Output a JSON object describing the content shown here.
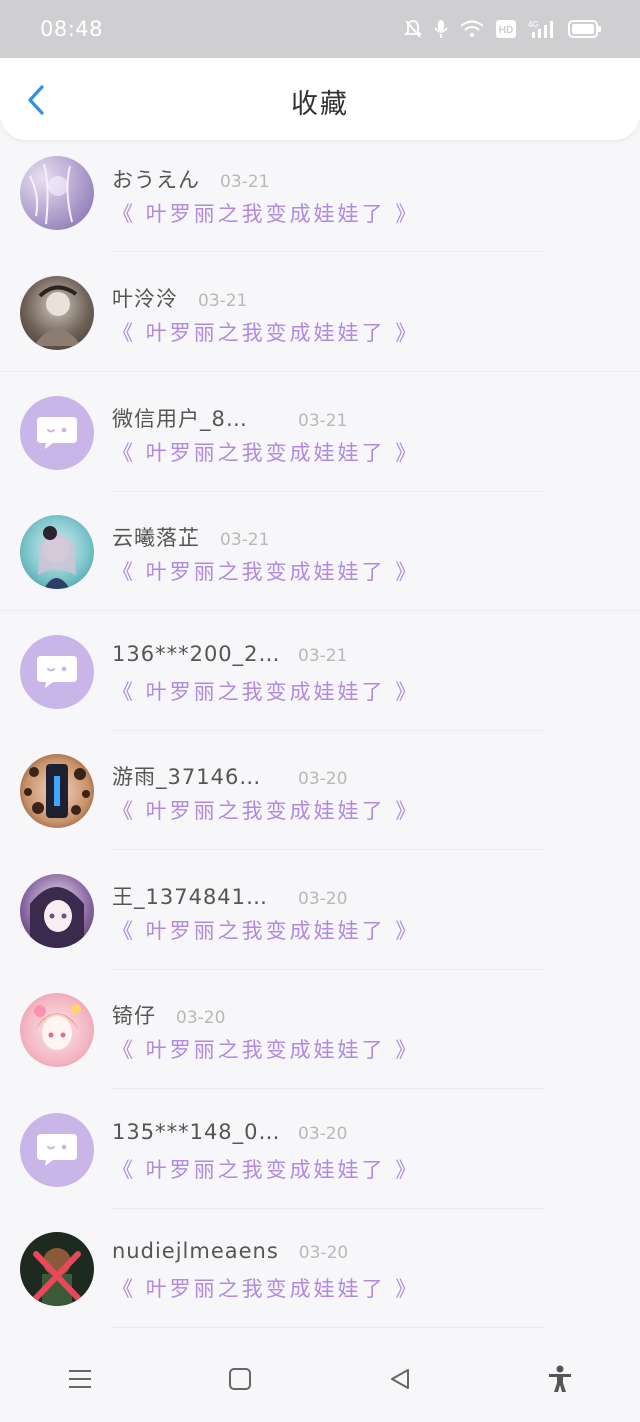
{
  "status_bar": {
    "time": "08:48",
    "icons": [
      "mute-bell-icon",
      "mic-icon",
      "wifi-icon",
      "hd-icon",
      "signal-4g-icon",
      "battery-icon"
    ],
    "badge_hd": "HD",
    "badge_4g": "4G"
  },
  "header": {
    "title": "收藏",
    "back_icon": "chevron-left-icon",
    "accent_color": "#2f8fe0"
  },
  "items": [
    {
      "username": "おうえん",
      "date": "03-21",
      "book": "《 叶罗丽之我变成娃娃了 》",
      "avatar": "photo"
    },
    {
      "username": "叶泠泠",
      "date": "03-21",
      "book": "《 叶罗丽之我变成娃娃了 》",
      "avatar": "photo"
    },
    {
      "username": "微信用户_8…",
      "date": "03-21",
      "book": "《 叶罗丽之我变成娃娃了 》",
      "avatar": "default"
    },
    {
      "username": "云曦落芷",
      "date": "03-21",
      "book": "《 叶罗丽之我变成娃娃了 》",
      "avatar": "photo"
    },
    {
      "username": "136***200_2…",
      "date": "03-21",
      "book": "《 叶罗丽之我变成娃娃了 》",
      "avatar": "default"
    },
    {
      "username": "游雨_37146…",
      "date": "03-20",
      "book": "《 叶罗丽之我变成娃娃了 》",
      "avatar": "photo"
    },
    {
      "username": "王_1374841…",
      "date": "03-20",
      "book": "《 叶罗丽之我变成娃娃了 》",
      "avatar": "photo"
    },
    {
      "username": "锜仔",
      "date": "03-20",
      "book": "《 叶罗丽之我变成娃娃了 》",
      "avatar": "photo"
    },
    {
      "username": "135***148_0…",
      "date": "03-20",
      "book": "《 叶罗丽之我变成娃娃了 》",
      "avatar": "default"
    },
    {
      "username": "nudiejlmeaens",
      "date": "03-20",
      "book": "《 叶罗丽之我变成娃娃了 》",
      "avatar": "photo"
    }
  ],
  "colors": {
    "book_title": "#b18ae0",
    "default_avatar": "#c9b5e8"
  },
  "system_nav": [
    "menu-icon",
    "home-square-icon",
    "back-triangle-icon",
    "accessibility-icon"
  ]
}
